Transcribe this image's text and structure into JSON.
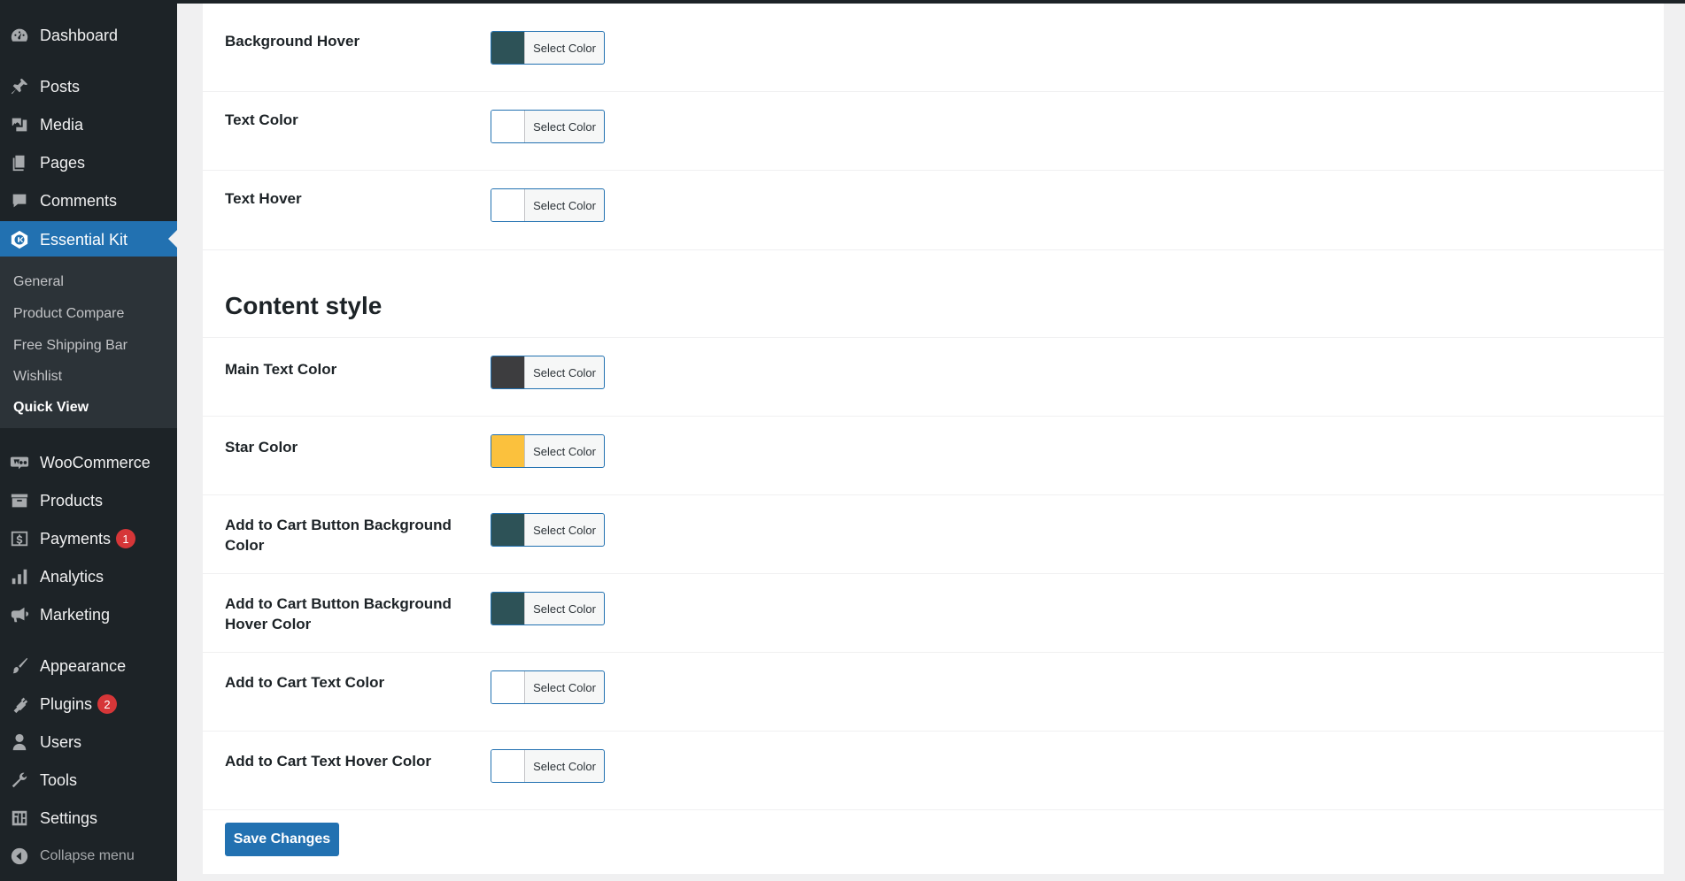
{
  "sidebar": {
    "items": [
      {
        "label": "Dashboard",
        "icon": "dashboard-icon"
      },
      {
        "label": "Posts",
        "icon": "pin-icon"
      },
      {
        "label": "Media",
        "icon": "media-icon"
      },
      {
        "label": "Pages",
        "icon": "pages-icon"
      },
      {
        "label": "Comments",
        "icon": "comment-icon"
      },
      {
        "label": "Essential Kit",
        "icon": "essential-kit-icon"
      },
      {
        "label": "WooCommerce",
        "icon": "woo-icon"
      },
      {
        "label": "Products",
        "icon": "archive-icon"
      },
      {
        "label": "Payments",
        "icon": "dollar-icon",
        "badge": "1"
      },
      {
        "label": "Analytics",
        "icon": "bar-chart-icon"
      },
      {
        "label": "Marketing",
        "icon": "megaphone-icon"
      },
      {
        "label": "Appearance",
        "icon": "brush-icon"
      },
      {
        "label": "Plugins",
        "icon": "plug-icon",
        "badge": "2"
      },
      {
        "label": "Users",
        "icon": "user-icon"
      },
      {
        "label": "Tools",
        "icon": "wrench-icon"
      },
      {
        "label": "Settings",
        "icon": "settings-icon"
      }
    ],
    "submenu": [
      "General",
      "Product Compare",
      "Free Shipping Bar",
      "Wishlist",
      "Quick View"
    ],
    "collapse_label": "Collapse menu"
  },
  "main": {
    "picker_label": "Select Color",
    "section_title": "Content style",
    "rows": [
      {
        "label": "Background Hover",
        "color": "#2d5257"
      },
      {
        "label": "Text Color",
        "color": "#ffffff"
      },
      {
        "label": "Text Hover",
        "color": "#ffffff"
      },
      {
        "label": "Main Text Color",
        "color": "#3d3d3f"
      },
      {
        "label": "Star Color",
        "color": "#fbc13d"
      },
      {
        "label": "Add to Cart Button Background Color",
        "color": "#2d5257"
      },
      {
        "label": "Add to Cart Button Background Hover Color",
        "color": "#2d5257"
      },
      {
        "label": "Add to Cart Text Color",
        "color": "#ffffff"
      },
      {
        "label": "Add to Cart Text Hover Color",
        "color": "#ffffff"
      }
    ],
    "save_label": "Save Changes"
  },
  "colors": {
    "admin_menu": "#1d2327",
    "submenu": "#2c3338",
    "accent": "#2271b1",
    "badge": "#d63638"
  }
}
